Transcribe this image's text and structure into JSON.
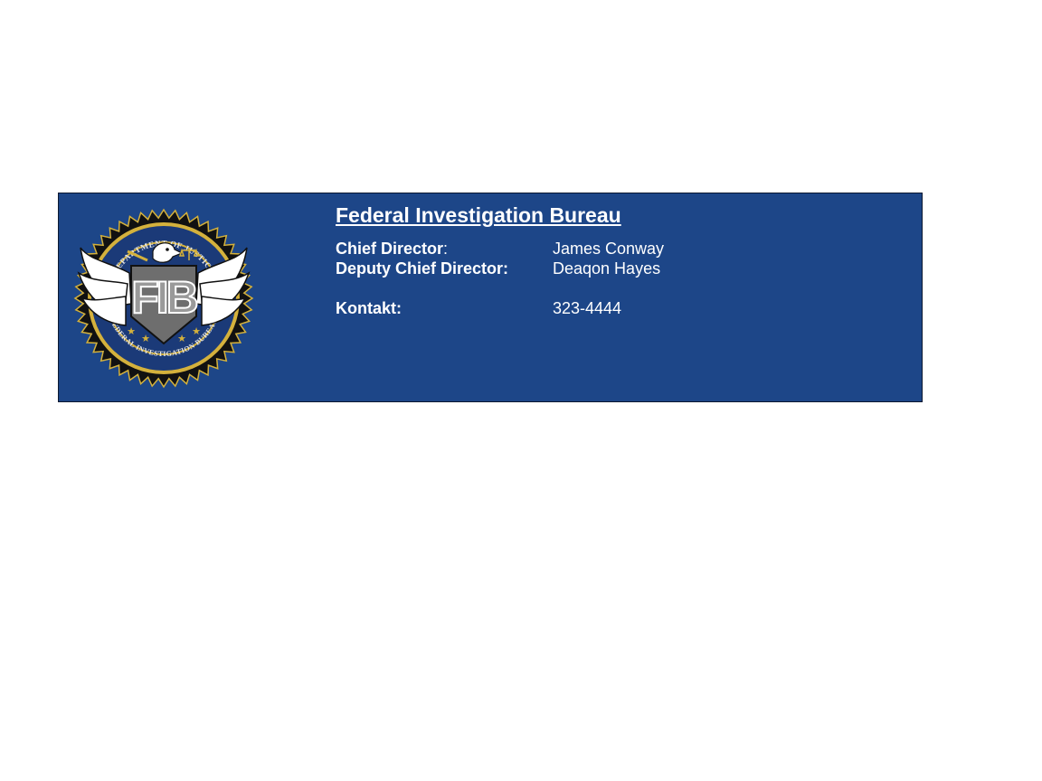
{
  "header": {
    "title": "Federal Investigation Bureau"
  },
  "contacts": [
    {
      "label": "Chief Director",
      "label_suffix": ":",
      "value": "James Conway"
    },
    {
      "label": "Deputy Chief Director:",
      "label_suffix": "",
      "value": "Deaqon Hayes"
    },
    {
      "label": "Kontakt:",
      "label_suffix": "",
      "value": "323-4444"
    }
  ],
  "seal": {
    "top_text": "DEPARTMENT OF JUSTICE",
    "bottom_text": "FEDERAL INVESTIGATION BUREAU",
    "center_text": "FIB",
    "icon": "fib-seal-icon"
  },
  "colors": {
    "banner_background": "#1d4688",
    "text": "#ffffff",
    "seal_gold": "#d4b13c",
    "seal_navy": "#1b3a78"
  }
}
